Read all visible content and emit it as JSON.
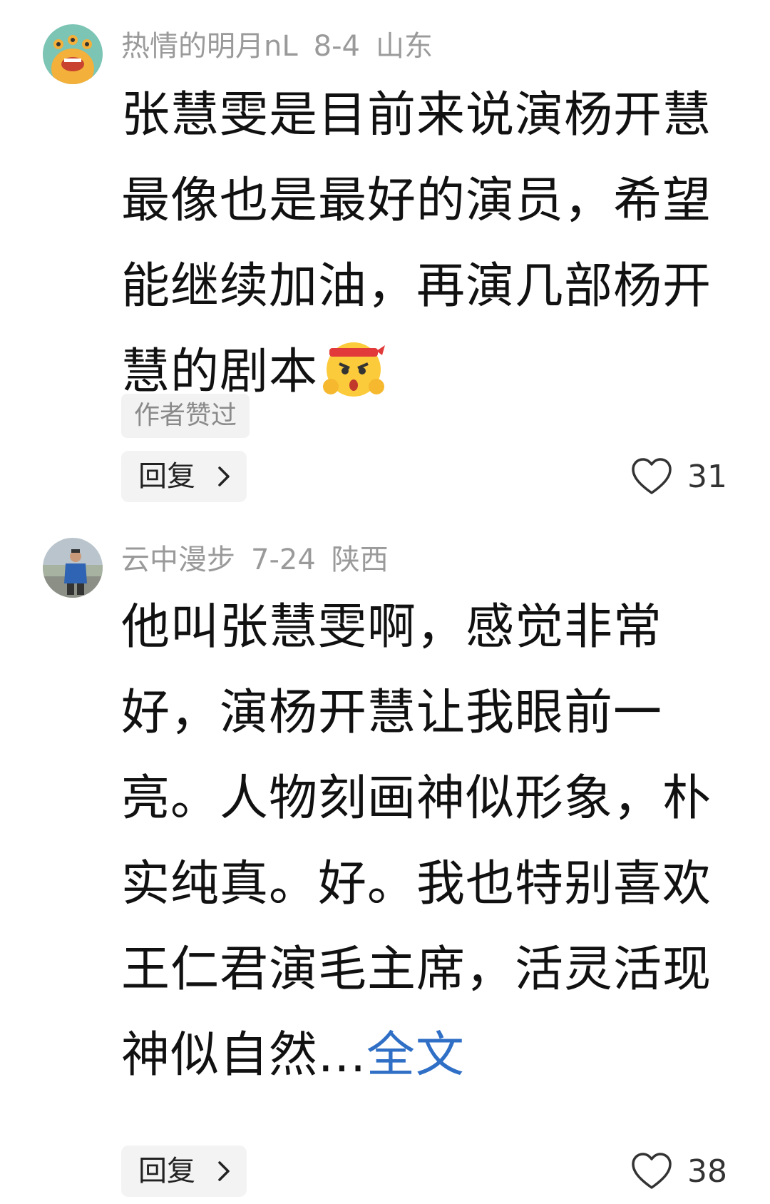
{
  "comments": [
    {
      "username": "热情的明月nL",
      "date": "8-4",
      "location": "山东",
      "text": "张慧雯是目前来说演杨开慧最像也是最好的演员，希望能继续加油，再演几部杨开慧的剧本",
      "emoji": "fighting-emoji",
      "tag": "作者赞过",
      "reply_label": "回复",
      "likes": "31"
    },
    {
      "username": "云中漫步",
      "date": "7-24",
      "location": "陕西",
      "text": "他叫张慧雯啊，感觉非常好，演杨开慧让我眼前一亮。人物刻画神似形象，朴实纯真。好。我也特别喜欢王仁君演毛主席，活灵活现神似自然...",
      "more_label": "全文",
      "reply_label": "回复",
      "likes": "38"
    }
  ],
  "colors": {
    "meta_text": "#9a9a9a",
    "link": "#2f6fc6",
    "button_bg": "#f3f3f3"
  },
  "icons": {
    "like": "heart-outline-icon",
    "reply_chevron": "chevron-right-icon"
  }
}
